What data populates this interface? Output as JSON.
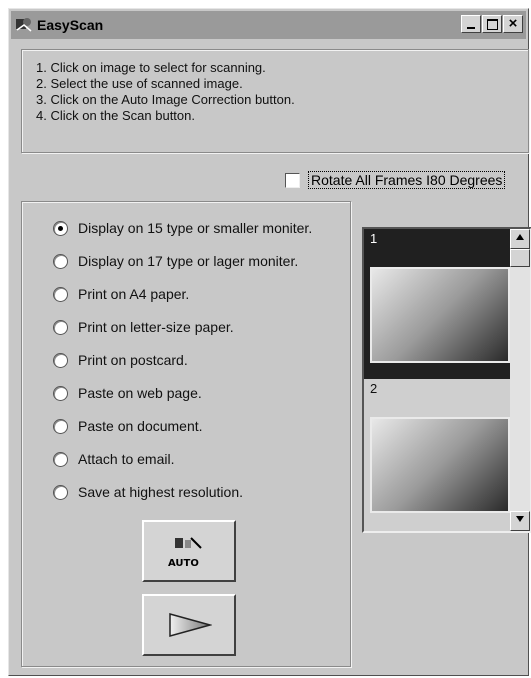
{
  "window": {
    "title": "EasyScan",
    "controls": {
      "minimize": "_",
      "close": "×"
    }
  },
  "instructions": [
    "1. Click on image to select for scanning.",
    "2. Select the use of scanned image.",
    "3. Click on the Auto Image Correction button.",
    "4. Click on the Scan button."
  ],
  "rotate": {
    "label": "Rotate All Frames I80 Degrees",
    "checked": false
  },
  "options": [
    {
      "label": "Display on 15 type or smaller moniter.",
      "checked": true
    },
    {
      "label": "Display on 17 type or lager moniter.",
      "checked": false
    },
    {
      "label": "Print on A4 paper.",
      "checked": false
    },
    {
      "label": "Print on letter-size paper.",
      "checked": false
    },
    {
      "label": "Print on postcard.",
      "checked": false
    },
    {
      "label": "Paste on web page.",
      "checked": false
    },
    {
      "label": "Paste on document.",
      "checked": false
    },
    {
      "label": "Attach to email.",
      "checked": false
    },
    {
      "label": "Save at highest resolution.",
      "checked": false
    }
  ],
  "buttons": {
    "auto_label": "AUTO"
  },
  "frames": [
    {
      "number": "1",
      "selected": true
    },
    {
      "number": "2",
      "selected": false
    }
  ]
}
